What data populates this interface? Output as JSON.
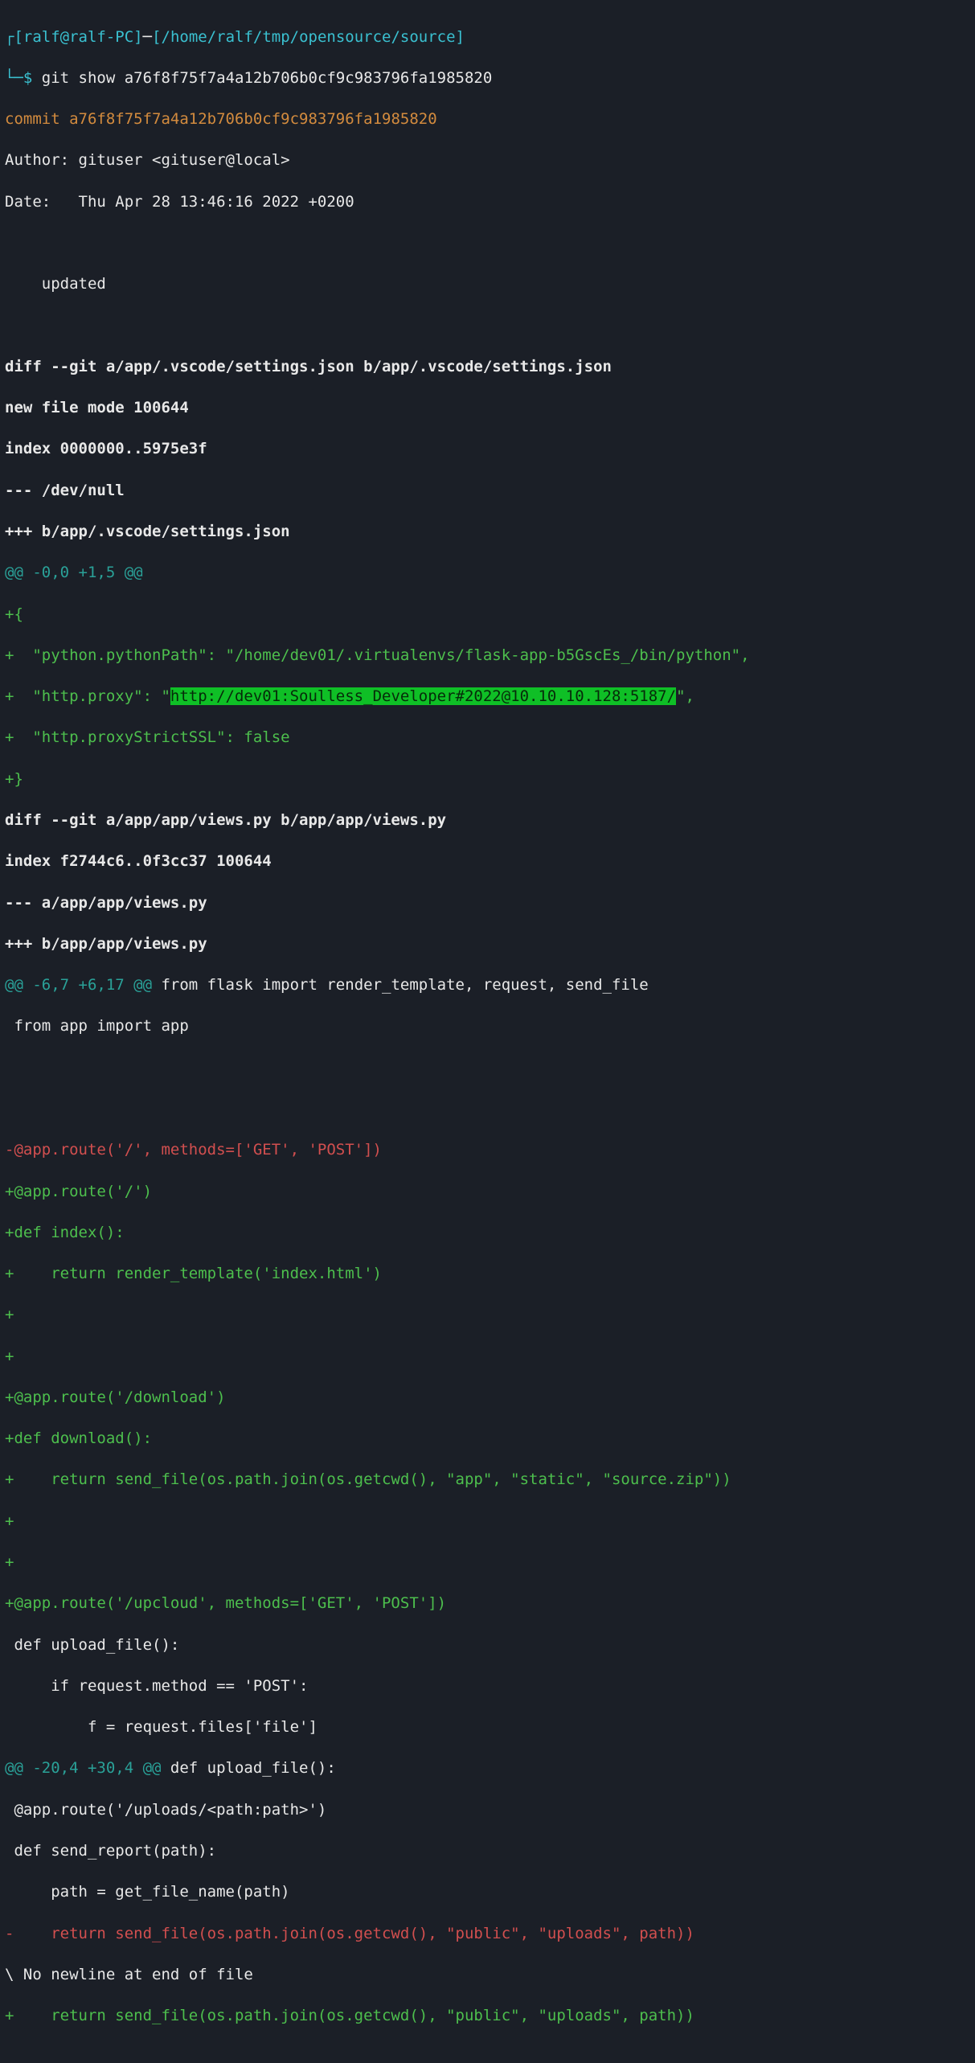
{
  "prompt": {
    "corner1": "┌",
    "userhost": "[ralf@ralf-PC]",
    "sep": "─",
    "path": "[/home/ralf/tmp/opensource/source]",
    "corner2": "└─",
    "dollar": "$ ",
    "cmd_git": "git",
    "cmd_args": " show a76f8f75f7a4a12b706b0cf9c983796fa1985820"
  },
  "commit": {
    "label": "commit ",
    "hash": "a76f8f75f7a4a12b706b0cf9c983796fa1985820",
    "author": "Author: gituser <gituser@local>",
    "date": "Date:   Thu Apr 28 13:46:16 2022 +0200",
    "msg": "    updated"
  },
  "diff1": {
    "header": "diff --git a/app/.vscode/settings.json b/app/.vscode/settings.json",
    "newmode": "new file mode 100644",
    "index": "index 0000000..5975e3f",
    "afile": "--- /dev/null",
    "bfile": "+++ b/app/.vscode/settings.json",
    "hunk": "@@ -0,0 +1,5 @@",
    "l1": "+{",
    "l2": "+  \"python.pythonPath\": \"/home/dev01/.virtualenvs/flask-app-b5GscEs_/bin/python\",",
    "l3a": "+  \"http.proxy\": \"",
    "l3_hl": "http://dev01:Soulless_Developer#2022@10.10.10.128:5187/",
    "l3b": "\",",
    "l4": "+  \"http.proxyStrictSSL\": false",
    "l5": "+}"
  },
  "diff2": {
    "header": "diff --git a/app/app/views.py b/app/app/views.py",
    "index": "index f2744c6..0f3cc37 100644",
    "afile": "--- a/app/app/views.py",
    "bfile": "+++ b/app/app/views.py",
    "hunk1_a": "@@ -6,7 +6,17 @@",
    "hunk1_b": " from flask import render_template, request, send_file",
    "ctx1": " from app import app",
    "blank": " ",
    "del1": "-@app.route('/', methods=['GET', 'POST'])",
    "add1": "+@app.route('/')",
    "add2": "+def index():",
    "add3": "+    return render_template('index.html')",
    "add4": "+",
    "add5": "+",
    "add6": "+@app.route('/download')",
    "add7": "+def download():",
    "add8": "+    return send_file(os.path.join(os.getcwd(), \"app\", \"static\", \"source.zip\"))",
    "add9": "+",
    "add10": "+",
    "add11": "+@app.route('/upcloud', methods=['GET', 'POST'])",
    "ctx2": " def upload_file():",
    "ctx3": "     if request.method == 'POST':",
    "ctx4": "         f = request.files['file']",
    "hunk2_a": "@@ -20,4 +30,4 @@",
    "hunk2_b": " def upload_file():",
    "ctx5": " @app.route('/uploads/<path:path>')",
    "ctx6": " def send_report(path):",
    "ctx7": "     path = get_file_name(path)",
    "del2": "-    return send_file(os.path.join(os.getcwd(), \"public\", \"uploads\", path))",
    "nonl": "\\ No newline at end of file",
    "add12": "+    return send_file(os.path.join(os.getcwd(), \"public\", \"uploads\", path))"
  }
}
